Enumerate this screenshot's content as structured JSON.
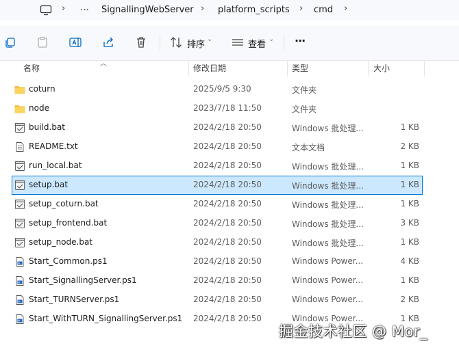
{
  "address_bar": {
    "overflow": "…",
    "crumbs": [
      "SignallingWebServer",
      "platform_scripts",
      "cmd"
    ]
  },
  "toolbar": {
    "sort_label": "排序",
    "view_label": "查看",
    "more_label": "···"
  },
  "columns": {
    "name": "名称",
    "date": "修改日期",
    "type": "类型",
    "size": "大小"
  },
  "files": [
    {
      "name": "coturn",
      "date": "2025/9/5 9:30",
      "type": "文件夹",
      "size": "",
      "icon": "folder-icon"
    },
    {
      "name": "node",
      "date": "2023/7/18 11:50",
      "type": "文件夹",
      "size": "",
      "icon": "folder-icon"
    },
    {
      "name": "build.bat",
      "date": "2024/2/18 20:50",
      "type": "Windows 批处理...",
      "size": "1 KB",
      "icon": "batch-file-icon"
    },
    {
      "name": "README.txt",
      "date": "2024/2/18 20:50",
      "type": "文本文档",
      "size": "2 KB",
      "icon": "text-file-icon"
    },
    {
      "name": "run_local.bat",
      "date": "2024/2/18 20:50",
      "type": "Windows 批处理...",
      "size": "1 KB",
      "icon": "batch-file-icon"
    },
    {
      "name": "setup.bat",
      "date": "2024/2/18 20:50",
      "type": "Windows 批处理...",
      "size": "1 KB",
      "icon": "batch-file-icon",
      "selected": true
    },
    {
      "name": "setup_coturn.bat",
      "date": "2024/2/18 20:50",
      "type": "Windows 批处理...",
      "size": "1 KB",
      "icon": "batch-file-icon"
    },
    {
      "name": "setup_frontend.bat",
      "date": "2024/2/18 20:50",
      "type": "Windows 批处理...",
      "size": "3 KB",
      "icon": "batch-file-icon"
    },
    {
      "name": "setup_node.bat",
      "date": "2024/2/18 20:50",
      "type": "Windows 批处理...",
      "size": "1 KB",
      "icon": "batch-file-icon"
    },
    {
      "name": "Start_Common.ps1",
      "date": "2024/2/18 20:50",
      "type": "Windows Power...",
      "size": "4 KB",
      "icon": "powershell-file-icon"
    },
    {
      "name": "Start_SignallingServer.ps1",
      "date": "2024/2/18 20:50",
      "type": "Windows Power...",
      "size": "1 KB",
      "icon": "powershell-file-icon"
    },
    {
      "name": "Start_TURNServer.ps1",
      "date": "2024/2/18 20:50",
      "type": "Windows Power...",
      "size": "2 KB",
      "icon": "powershell-file-icon"
    },
    {
      "name": "Start_WithTURN_SignallingServer.ps1",
      "date": "2024/2/18 20:50",
      "type": "Windows Power...",
      "size": "1 KB",
      "icon": "powershell-file-icon"
    }
  ],
  "watermark": "掘金技术社区 @ Mor_",
  "colors": {
    "selection": "#cce8ff",
    "selection_border": "#0078d4",
    "folder": "#f8c33a"
  }
}
